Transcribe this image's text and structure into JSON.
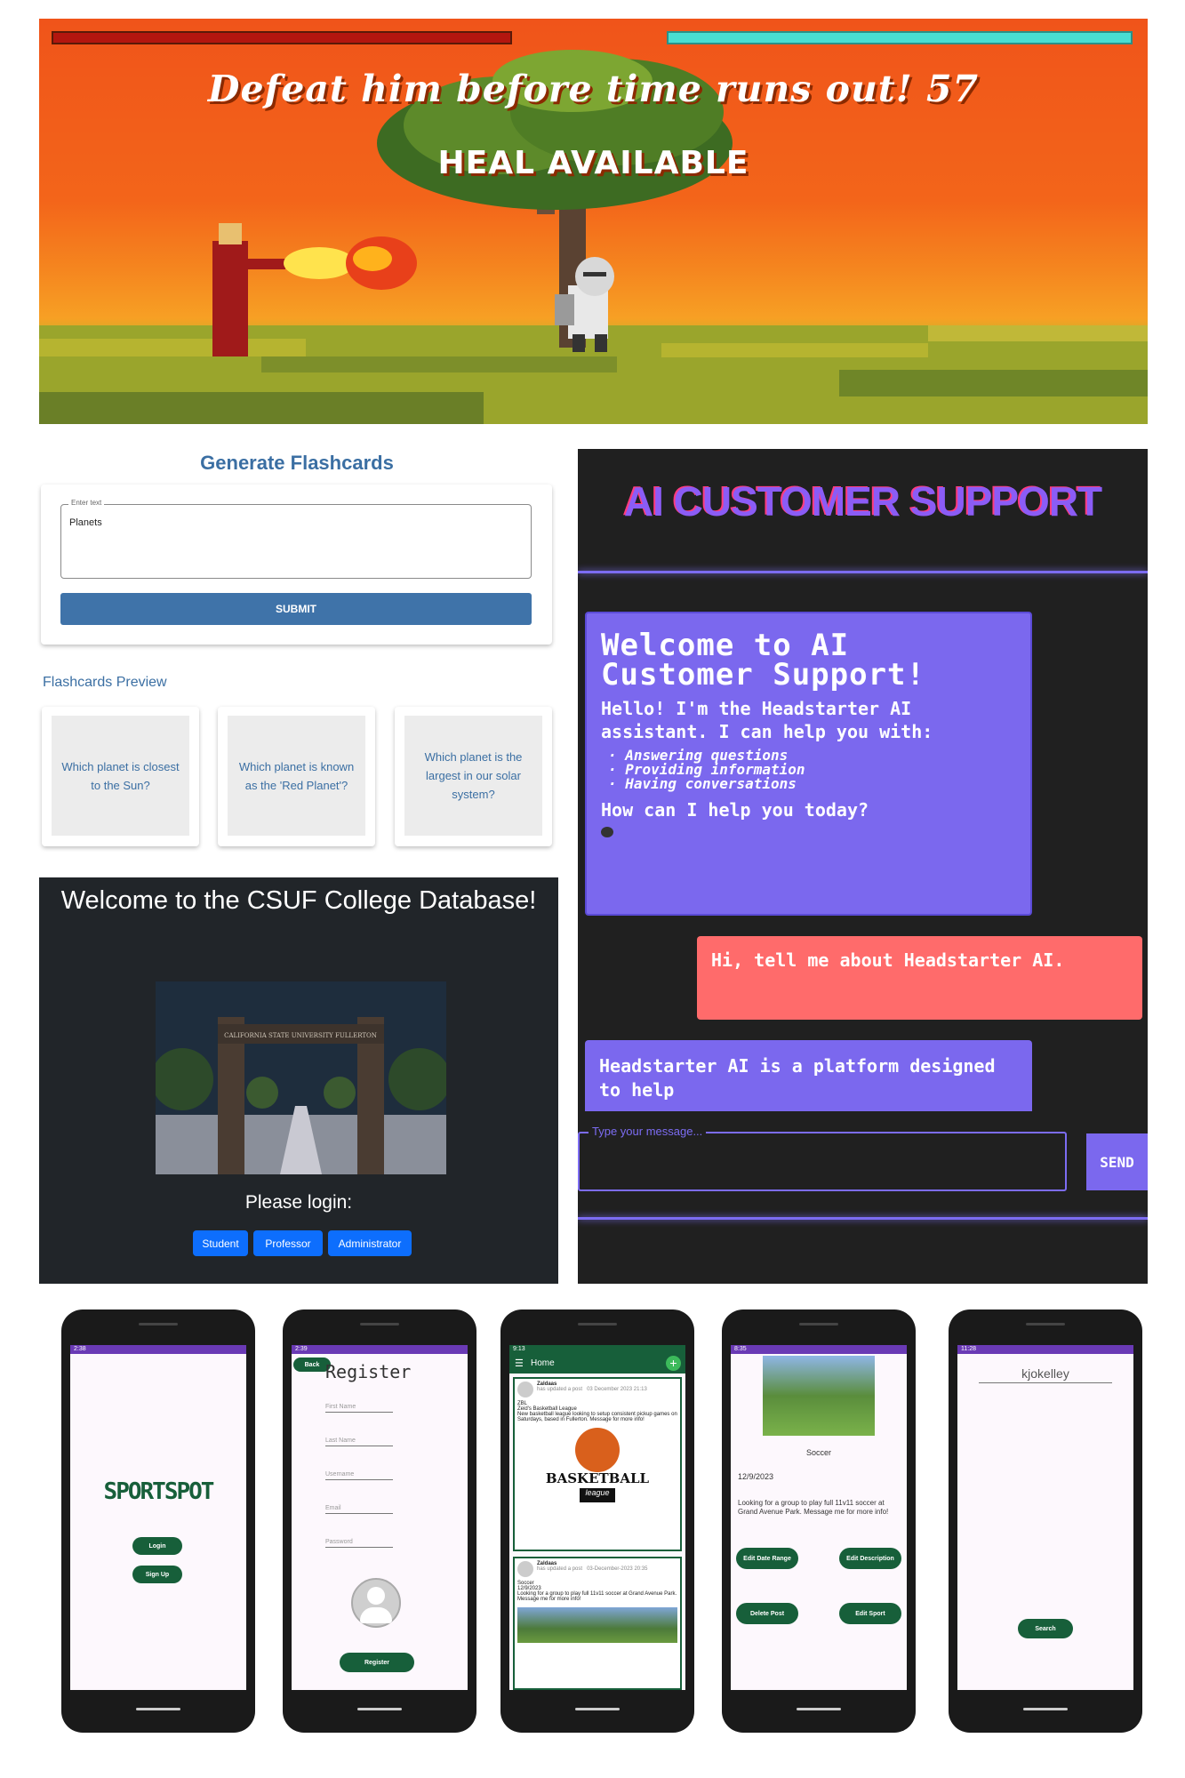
{
  "game": {
    "timer_text": "Defeat him before time runs out! 57",
    "heal_text": "HEAL AVAILABLE",
    "player_health": 1.0,
    "enemy_health": 1.0
  },
  "flashcards": {
    "title": "Generate Flashcards",
    "input_label": "Enter text",
    "input_value": "Planets",
    "submit_label": "SUBMIT",
    "preview_title": "Flashcards Preview",
    "cards": [
      "Which planet is closest to the Sun?",
      "Which planet is known as the 'Red Planet'?",
      "Which planet is the largest in our solar system?"
    ]
  },
  "csuf": {
    "title": "Welcome to the CSUF College Database!",
    "photo_sign": "CALIFORNIA STATE UNIVERSITY FULLERTON",
    "login_prompt": "Please login:",
    "buttons": [
      "Student",
      "Professor",
      "Administrator"
    ]
  },
  "ai_support": {
    "title": "AI CUSTOMER SUPPORT",
    "bot_welcome_heading": "Welcome to AI Customer Support!",
    "bot_intro": "Hello! I'm the Headstarter AI assistant. I can help you with:",
    "bot_list": [
      "Answering questions",
      "Providing information",
      "Having conversations"
    ],
    "bot_question": "How can I help you today?",
    "user_message": "Hi, tell me about Headstarter AI.",
    "bot_reply_partial": "Headstarter AI is a platform designed to help",
    "input_placeholder": "Type your message...",
    "send_label": "SEND"
  },
  "phones": {
    "splash": {
      "status_time": "2:38",
      "logo": "SPORTSPOT",
      "login": "Login",
      "signup": "Sign Up"
    },
    "register": {
      "status_time": "2:39",
      "back": "Back",
      "title": "Register",
      "fields": [
        "First Name",
        "Last Name",
        "Username",
        "Email",
        "Password"
      ],
      "submit": "Register"
    },
    "home": {
      "status_time": "9:13",
      "title": "Home",
      "posts": [
        {
          "user": "Zaldaas",
          "meta": "has updated a post",
          "date": "03 December 2023",
          "time": "21:13",
          "sport": "ZBL",
          "title": "Zeid's Basketball League",
          "body": "New basketball league looking to setup consistent pickup games on Saturdays, based in Fullerton. Message for more info!",
          "image_text": "BASKETBALL",
          "image_sub": "league"
        },
        {
          "user": "Zaldaas",
          "meta": "has updated a post",
          "date": "03-December-2023",
          "time": "20:35",
          "sport": "Soccer",
          "title": "12/9/2023",
          "body": "Looking for a group to play full 11v11 soccer at Grand Avenue Park. Message me for more info!"
        }
      ]
    },
    "post_detail": {
      "status_time": "8:35",
      "sport": "Soccer",
      "date": "12/9/2023",
      "body": "Looking for a group to play full 11v11 soccer at Grand Avenue Park. Message me for more info!",
      "buttons": [
        "Edit Date Range",
        "Edit Description",
        "Delete Post",
        "Edit Sport"
      ]
    },
    "search": {
      "status_time": "11:28",
      "query": "kjokelley",
      "button": "Search"
    }
  }
}
